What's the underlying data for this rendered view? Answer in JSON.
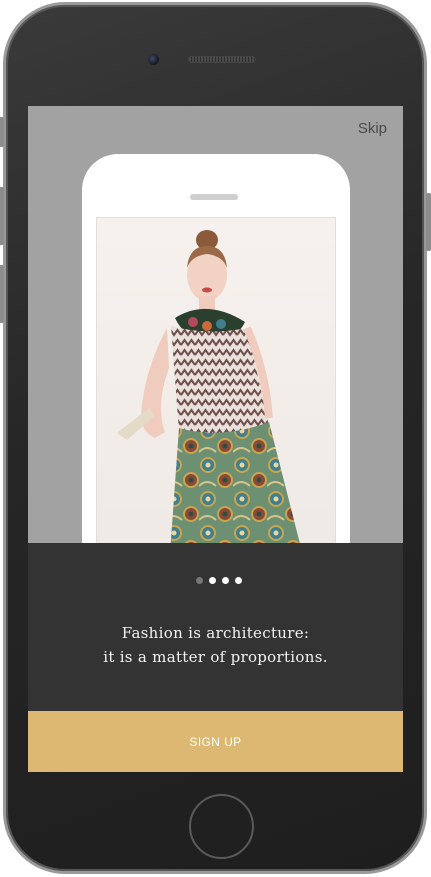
{
  "onboarding": {
    "skip_label": "Skip",
    "tagline_line1": "Fashion is architecture:",
    "tagline_line2": "it is a matter of proportions.",
    "signup_label": "SIGN UP",
    "pagination": {
      "total": 4,
      "active_index": 0
    },
    "hero_image": {
      "description_icon": "fashion-model-photo"
    }
  },
  "colors": {
    "screen_background": "#a2a2a2",
    "panel_background": "#333333",
    "signup_button": "#dcb872",
    "dot_active": "#ffffff",
    "dot_inactive": "#777777"
  }
}
